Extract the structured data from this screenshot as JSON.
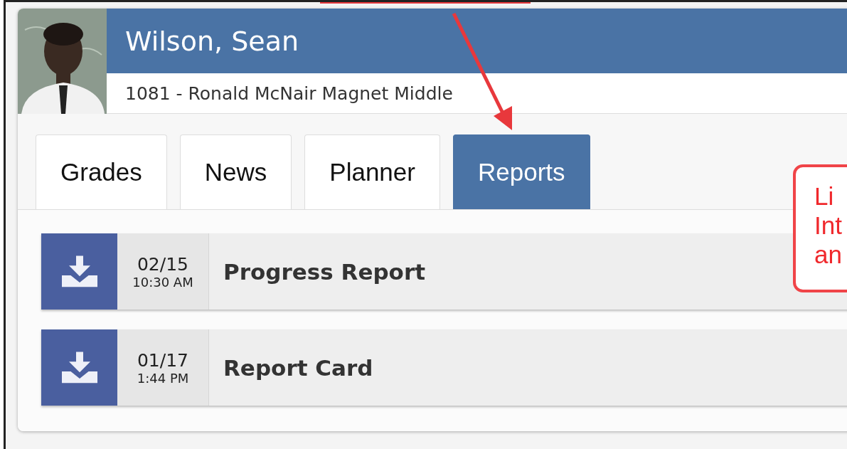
{
  "student": {
    "name": "Wilson, Sean",
    "school": "1081 - Ronald McNair Magnet Middle"
  },
  "tabs": [
    {
      "label": "Grades",
      "selected": false
    },
    {
      "label": "News",
      "selected": false
    },
    {
      "label": "Planner",
      "selected": false
    },
    {
      "label": "Reports",
      "selected": true
    }
  ],
  "reports": [
    {
      "date": "02/15",
      "time": "10:30 AM",
      "title": "Progress Report"
    },
    {
      "date": "01/17",
      "time": "1:44 PM",
      "title": "Report Card"
    }
  ],
  "callout": {
    "lines": [
      "Li",
      "Int",
      "an"
    ]
  }
}
